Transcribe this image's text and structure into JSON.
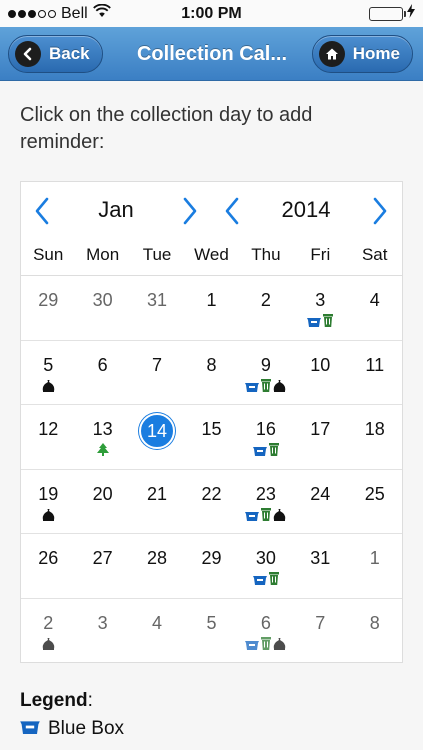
{
  "status": {
    "carrier": "Bell",
    "time": "1:00 PM",
    "battery_color": "#4cd964"
  },
  "header": {
    "back_label": "Back",
    "title": "Collection Cal...",
    "home_label": "Home"
  },
  "instructions": "Click on the collection day to add reminder:",
  "calendar": {
    "month": "Jan",
    "year": "2014",
    "weekdays": [
      "Sun",
      "Mon",
      "Tue",
      "Wed",
      "Thu",
      "Fri",
      "Sat"
    ],
    "weeks": [
      [
        {
          "d": "29",
          "other": true,
          "icons": []
        },
        {
          "d": "30",
          "other": true,
          "icons": []
        },
        {
          "d": "31",
          "other": true,
          "icons": []
        },
        {
          "d": "1",
          "icons": []
        },
        {
          "d": "2",
          "icons": []
        },
        {
          "d": "3",
          "icons": [
            "bluebox",
            "greenbin"
          ]
        },
        {
          "d": "4",
          "icons": []
        }
      ],
      [
        {
          "d": "5",
          "icons": [
            "garbage"
          ]
        },
        {
          "d": "6",
          "icons": []
        },
        {
          "d": "7",
          "icons": []
        },
        {
          "d": "8",
          "icons": []
        },
        {
          "d": "9",
          "icons": [
            "bluebox",
            "greenbin",
            "garbage"
          ]
        },
        {
          "d": "10",
          "icons": []
        },
        {
          "d": "11",
          "icons": []
        }
      ],
      [
        {
          "d": "12",
          "icons": []
        },
        {
          "d": "13",
          "icons": [
            "tree"
          ]
        },
        {
          "d": "14",
          "today": true,
          "icons": []
        },
        {
          "d": "15",
          "icons": []
        },
        {
          "d": "16",
          "icons": [
            "bluebox",
            "greenbin"
          ]
        },
        {
          "d": "17",
          "icons": []
        },
        {
          "d": "18",
          "icons": []
        }
      ],
      [
        {
          "d": "19",
          "icons": [
            "garbage"
          ]
        },
        {
          "d": "20",
          "icons": []
        },
        {
          "d": "21",
          "icons": []
        },
        {
          "d": "22",
          "icons": []
        },
        {
          "d": "23",
          "icons": [
            "bluebox",
            "greenbin",
            "garbage"
          ]
        },
        {
          "d": "24",
          "icons": []
        },
        {
          "d": "25",
          "icons": []
        }
      ],
      [
        {
          "d": "26",
          "icons": []
        },
        {
          "d": "27",
          "icons": []
        },
        {
          "d": "28",
          "icons": []
        },
        {
          "d": "29",
          "icons": []
        },
        {
          "d": "30",
          "icons": [
            "bluebox",
            "greenbin"
          ]
        },
        {
          "d": "31",
          "icons": []
        },
        {
          "d": "1",
          "other": true,
          "icons": []
        }
      ],
      [
        {
          "d": "2",
          "other": true,
          "icons": [
            "garbage"
          ]
        },
        {
          "d": "3",
          "other": true,
          "icons": []
        },
        {
          "d": "4",
          "other": true,
          "icons": []
        },
        {
          "d": "5",
          "other": true,
          "icons": []
        },
        {
          "d": "6",
          "other": true,
          "icons": [
            "bluebox",
            "greenbin",
            "garbage"
          ]
        },
        {
          "d": "7",
          "other": true,
          "icons": []
        },
        {
          "d": "8",
          "other": true,
          "icons": []
        }
      ]
    ]
  },
  "colors": {
    "accent": "#1a7de0",
    "blue_box": "#1565c0",
    "green_bin": "#2e7d32",
    "garbage": "#111111",
    "tree": "#2e9d3a"
  },
  "legend": {
    "title": "Legend",
    "colon": ":",
    "items": [
      {
        "icon": "bluebox",
        "label": "Blue Box"
      }
    ]
  }
}
